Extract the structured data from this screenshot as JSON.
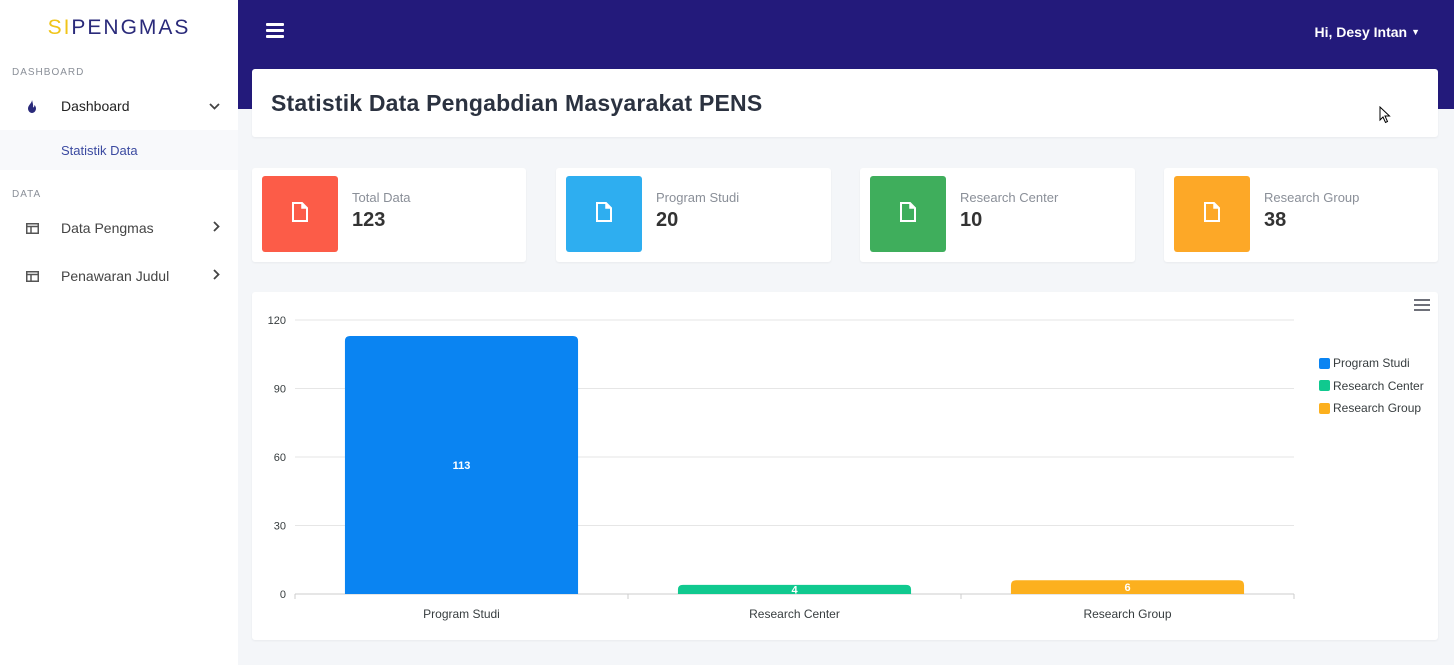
{
  "brand": {
    "part1": "SI",
    "part2": "PENGMAS"
  },
  "sidebar": {
    "heading_dashboard": "DASHBOARD",
    "heading_data": "DATA",
    "items": [
      {
        "label": "Dashboard",
        "icon": "fire-icon"
      },
      {
        "label": "Data Pengmas",
        "icon": "table-icon"
      },
      {
        "label": "Penawaran Judul",
        "icon": "table-icon"
      }
    ],
    "submenu": {
      "label": "Statistik Data"
    }
  },
  "topbar": {
    "user_label": "Hi, Desy Intan"
  },
  "page": {
    "title": "Statistik Data Pengabdian Masyarakat PENS"
  },
  "stats": [
    {
      "label": "Total Data",
      "value": "123",
      "color": "#fc5c48",
      "icon": "file-icon"
    },
    {
      "label": "Program Studi",
      "value": "20",
      "color": "#2eaef0",
      "icon": "file-icon"
    },
    {
      "label": "Research Center",
      "value": "10",
      "color": "#3fae5c",
      "icon": "file-icon"
    },
    {
      "label": "Research Group",
      "value": "38",
      "color": "#fda827",
      "icon": "file-icon"
    }
  ],
  "chart_data": {
    "type": "bar",
    "categories": [
      "Program Studi",
      "Research Center",
      "Research Group"
    ],
    "values": [
      113,
      4,
      6
    ],
    "colors": [
      "#0a84f2",
      "#10c98f",
      "#fcb01e"
    ],
    "legend": [
      "Program Studi",
      "Research Center",
      "Research Group"
    ],
    "legend_position": "right",
    "ylim": [
      0,
      120
    ],
    "yticks": [
      0,
      30,
      60,
      90,
      120
    ],
    "grid": true,
    "data_labels": true
  }
}
